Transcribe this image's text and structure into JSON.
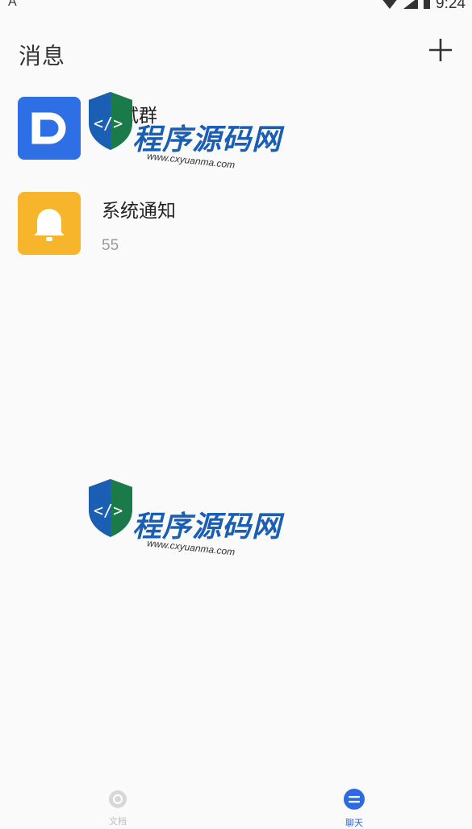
{
  "status_bar": {
    "left_glyph": "A",
    "time": "9:24"
  },
  "header": {
    "title": "消息"
  },
  "chats": [
    {
      "name": "一试群",
      "preview": "",
      "avatar_color": "#2f6fe6",
      "avatar_letter": "D"
    },
    {
      "name": "系统通知",
      "preview": "55",
      "avatar_color": "#f6b52b",
      "icon": "bell-icon"
    }
  ],
  "watermark": {
    "text": "程序源码网",
    "url": "www.cxyuanma.com"
  },
  "tabs": [
    {
      "label": "文档",
      "icon": "document-icon",
      "active": false
    },
    {
      "label": "聊天",
      "icon": "chat-bubble-icon",
      "active": true
    }
  ],
  "colors": {
    "accent": "#2d69e0",
    "blue_avatar": "#2f6fe6",
    "orange_avatar": "#f6b52b"
  }
}
